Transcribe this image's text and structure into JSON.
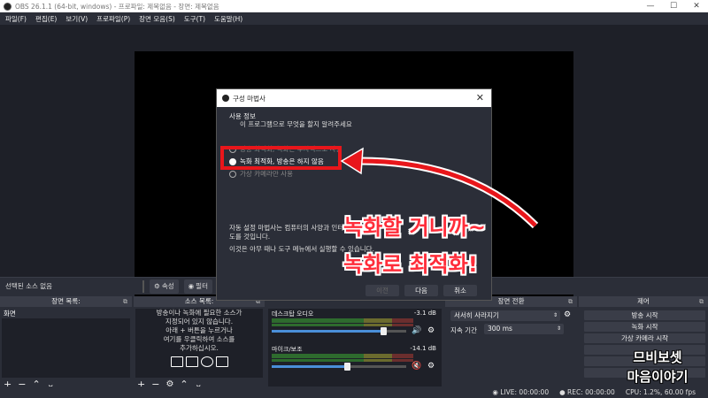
{
  "window": {
    "title": "OBS 26.1.1 (64-bit, windows) - 프로파일: 제목없음 - 장면: 제목없음",
    "controls": [
      "—",
      "☐",
      "✕"
    ]
  },
  "menu": [
    "파일(F)",
    "편집(E)",
    "보기(V)",
    "프로파일(P)",
    "장면 모음(S)",
    "도구(T)",
    "도움말(H)"
  ],
  "source_bar": {
    "no_source": "선택된 소스 없음",
    "properties": "속성",
    "filters": "필터"
  },
  "docks": {
    "scenes": {
      "title": "장면 목록:",
      "items": [
        "화면"
      ]
    },
    "sources": {
      "title": "소스 목록:",
      "hint_lines": [
        "방송이나 녹화에 필요한 소스가",
        "지정되어 있지 않습니다.",
        "아래 + 버튼을 누르거나",
        "여기를 우클릭하여 소스를",
        "추가하십시오."
      ]
    },
    "mixer": {
      "tracks": [
        {
          "name": "데스크탑 오디오",
          "db": "-3.1 dB",
          "volume": 0.83,
          "muted": false
        },
        {
          "name": "마이크/보조",
          "db": "-14.1 dB",
          "volume": 0.56,
          "muted": true
        }
      ]
    },
    "transitions": {
      "title": "장면 전환",
      "selected": "서서히 사라지기",
      "duration_label": "지속 기간",
      "duration_value": "300 ms"
    },
    "controls": {
      "title": "제어",
      "buttons": [
        "방송 시작",
        "녹화 시작",
        "가상 카메라 시작"
      ]
    }
  },
  "status": {
    "live": "LIVE: 00:00:00",
    "rec": "REC: 00:00:00",
    "cpu": "CPU: 1.2%, 60.00 fps"
  },
  "dialog": {
    "title": "구성 마법사",
    "section_title": "사용 정보",
    "section_sub": "이 프로그램으로 무엇을 할지 알려주세요",
    "options": [
      "방송 최적화, 녹화는 부차적으로 사용",
      "녹화 최적화, 방송은 하지 않음",
      "가상 카메라만 사용"
    ],
    "selected_option": 1,
    "info1": "자동 설정 마법사는 컴퓨터의 사양과 인터넷 속도를 것입니다.",
    "info2": "이것은 아무 때나 도구 메뉴에서 실행할 수 있습니다.",
    "buttons": {
      "prev": "이전",
      "next": "다음",
      "cancel": "취소"
    }
  },
  "annotation": {
    "line1": "녹화할 거니까~",
    "line2": "녹화로 최적화!"
  },
  "watermark": {
    "line1": "므비보셋",
    "line2": "마음이야기"
  },
  "colors": {
    "highlight": "#e8161b",
    "annotation_text": "#ff2d3a"
  }
}
